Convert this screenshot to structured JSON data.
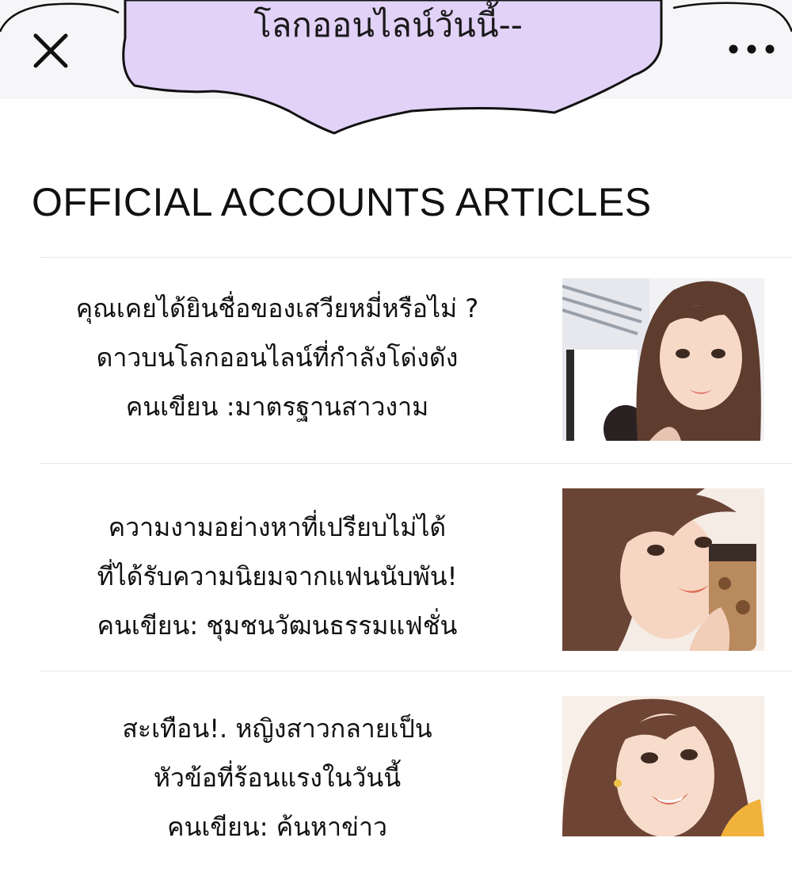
{
  "header": {
    "close_icon": "close-icon",
    "more_icon": "more-horizontal-icon",
    "speech_bubble_text": "โลกออนไลน์วันนี้--",
    "bubble_color": "#e2d2f8",
    "bar_color": "#f6f6f8"
  },
  "section": {
    "title": "OFFICIAL ACCOUNTS ARTICLES"
  },
  "articles": [
    {
      "lines": [
        "คุณเคยได้ยินชื่อของเสวียหมี่หรือไม่ ?",
        "ดาวบนโลกออนไลน์ที่กำลังโด่งดัง",
        "คนเขียน :มาตรฐานสาวงาม"
      ],
      "thumbnail": "woman-portrait-image"
    },
    {
      "lines": [
        "ความงามอย่างหาที่เปรียบไม่ได้",
        "ที่ได้รับความนิยมจากแฟนนับพัน!",
        "คนเขียน: ชุมชนวัฒนธรรมแฟชั่น"
      ],
      "thumbnail": "woman-with-drink-image"
    },
    {
      "lines": [
        "สะเทือน!. หญิงสาวกลายเป็น",
        "หัวข้อที่ร้อนแรงในวันนี้",
        "คนเขียน: ค้นหาข่าว"
      ],
      "thumbnail": "smiling-woman-image"
    }
  ]
}
